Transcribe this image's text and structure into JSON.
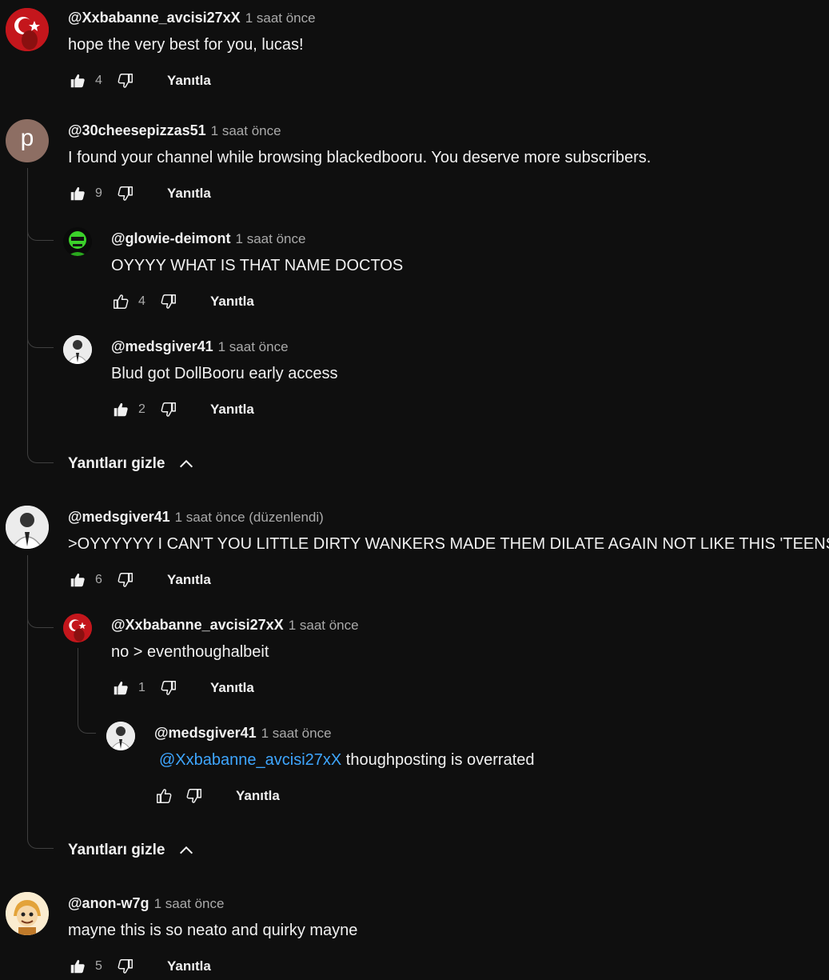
{
  "labels": {
    "reply": "Yanıtla",
    "hide_replies": "Yanıtları gizle"
  },
  "comments": [
    {
      "author": "@Xxbabanne_avcisi27xX",
      "time": "1 saat önce",
      "text": "hope the very best for you, lucas!",
      "likes": "4"
    },
    {
      "author": "@30cheesepizzas51",
      "time": "1 saat önce",
      "text": "I found your channel while browsing blackedbooru. You deserve more subscribers.",
      "likes": "9",
      "avatar_letter": "p"
    },
    {
      "author": "@glowie-deimont",
      "time": "1 saat önce",
      "text": "OYYYY WHAT IS THAT NAME DOCTOS",
      "likes": "4"
    },
    {
      "author": "@medsgiver41",
      "time": "1 saat önce",
      "text": "Blud got DollBooru early access",
      "likes": "2"
    },
    {
      "author": "@medsgiver41",
      "time": "1 saat önce (düzenlendi)",
      "text": ">OYYYYYY I CAN'T YOU LITTLE DIRTY WANKERS MADE THEM DILATE AGAIN NOT LIKE THIS 'TEENS",
      "likes": "6"
    },
    {
      "author": "@Xxbabanne_avcisi27xX",
      "time": "1 saat önce",
      "text": "no > eventhoughalbeit",
      "likes": "1"
    },
    {
      "author": "@medsgiver41",
      "time": "1 saat önce",
      "mention": "@Xxbabanne_avcisi27xX",
      "text": " thoughposting is overrated",
      "likes": ""
    },
    {
      "author": "@anon-w7g",
      "time": "1 saat önce",
      "text": "mayne this is so neato and quirky mayne",
      "likes": "5"
    }
  ],
  "colors": {
    "background": "#0f0f0f",
    "text": "#f1f1f1",
    "secondary": "#aaaaaa",
    "mention": "#3ea6ff",
    "thread_line": "#3f3f3f"
  }
}
